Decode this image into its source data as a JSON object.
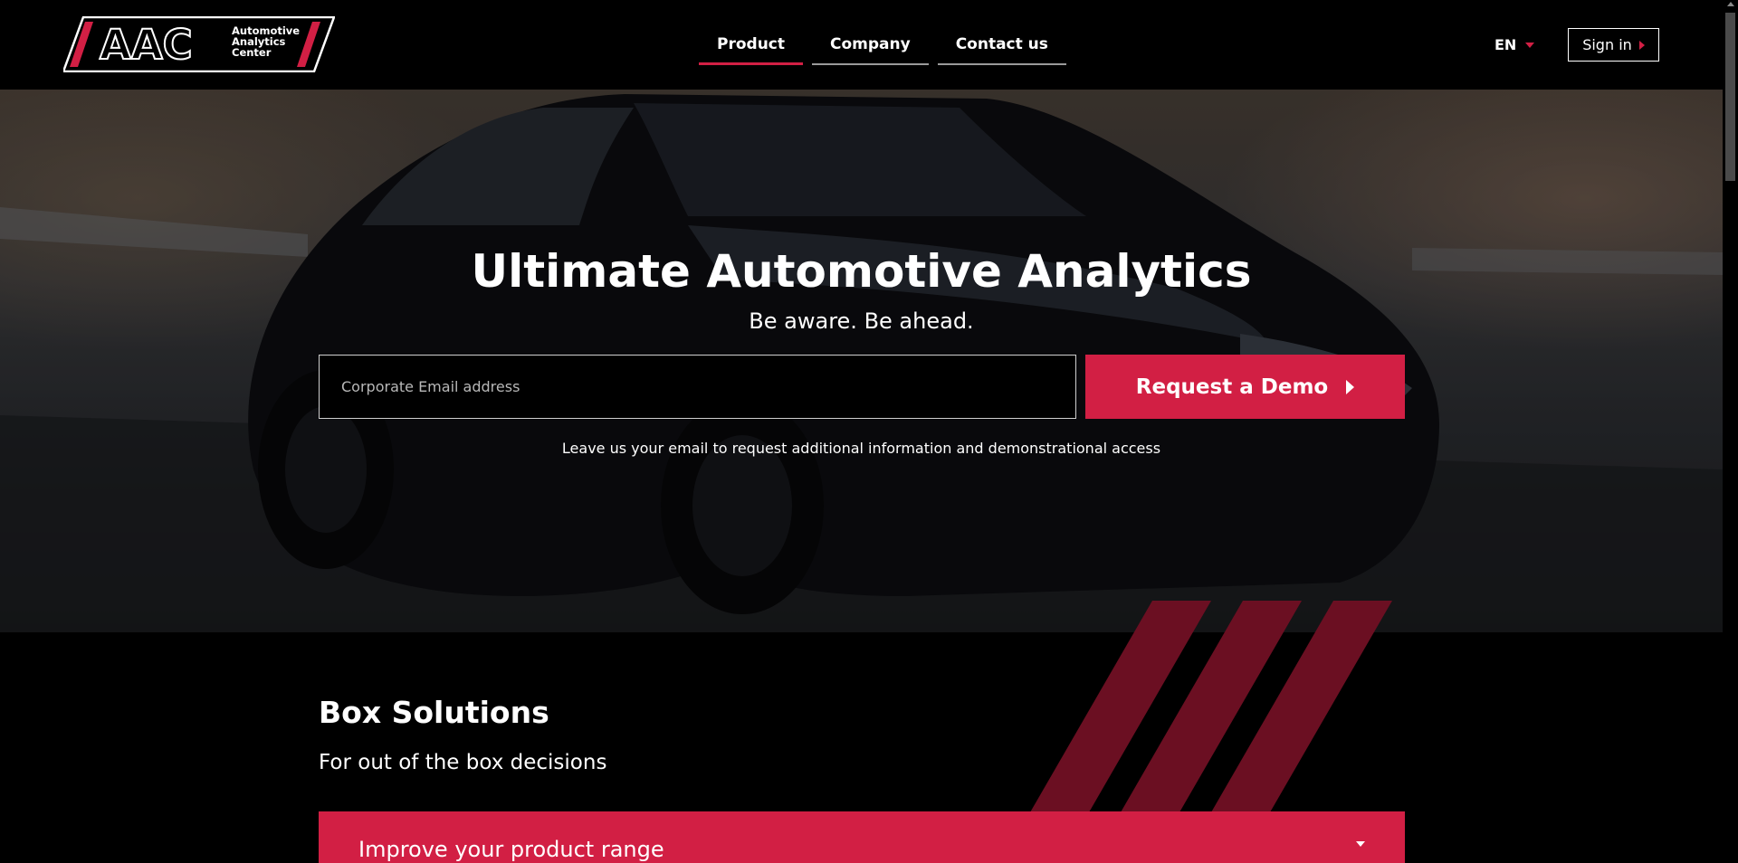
{
  "header": {
    "logo": {
      "mark": "AAC",
      "lines": [
        "Automotive",
        "Analytics",
        "Center"
      ]
    },
    "nav": [
      {
        "label": "Product",
        "active": true
      },
      {
        "label": "Company",
        "active": false
      },
      {
        "label": "Contact us",
        "active": false
      }
    ],
    "language": "EN",
    "signin_label": "Sign in"
  },
  "hero": {
    "title": "Ultimate Automotive Analytics",
    "subtitle": "Be aware. Be ahead.",
    "email_placeholder": "Corporate Email address",
    "email_value": "",
    "demo_button_label": "Request a Demo",
    "note": "Leave us your email to request additional information and demonstrational access"
  },
  "solutions": {
    "title": "Box Solutions",
    "subtitle": "For out of the box decisions",
    "accordion_label": "Improve your product range"
  },
  "colors": {
    "accent": "#d21f44",
    "stripe": "#6b0f22",
    "background": "#000000"
  }
}
